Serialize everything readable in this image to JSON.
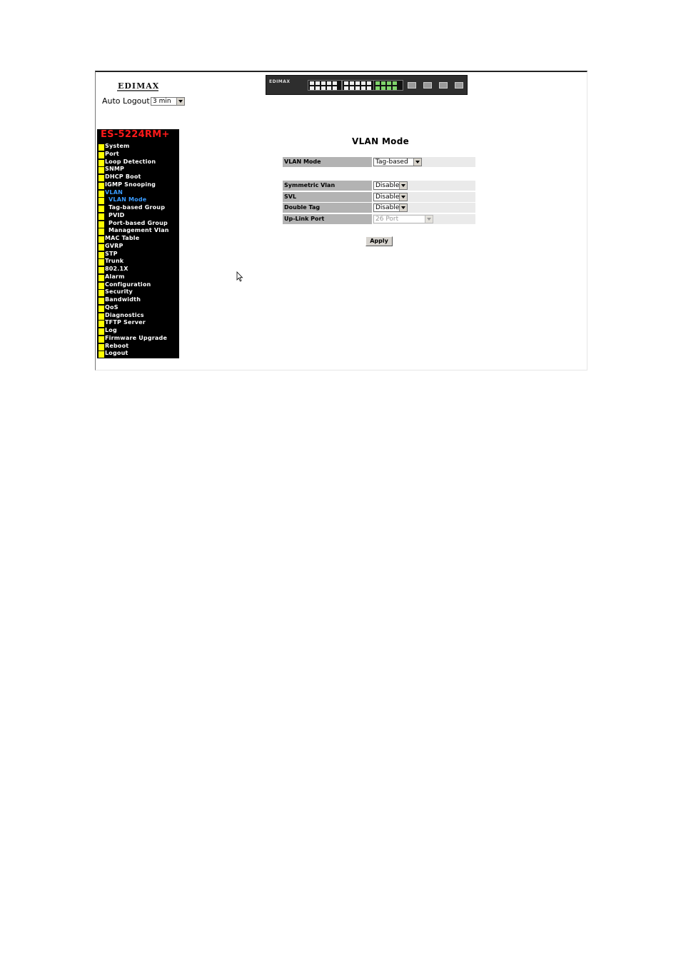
{
  "header": {
    "brand_logo_text": "EDIMAX",
    "auto_logout_label": "Auto Logout",
    "auto_logout_value": "3 min",
    "switch_panel_brand": "EDIMAX"
  },
  "sidebar": {
    "model": "ES-5224RM+",
    "items": [
      {
        "label": "System",
        "indent": false,
        "active": false
      },
      {
        "label": "Port",
        "indent": false,
        "active": false
      },
      {
        "label": "Loop Detection",
        "indent": false,
        "active": false
      },
      {
        "label": "SNMP",
        "indent": false,
        "active": false
      },
      {
        "label": "DHCP Boot",
        "indent": false,
        "active": false
      },
      {
        "label": "IGMP Snooping",
        "indent": false,
        "active": false
      },
      {
        "label": "VLAN",
        "indent": false,
        "active": true
      },
      {
        "label": "VLAN Mode",
        "indent": true,
        "active": true
      },
      {
        "label": "Tag-based Group",
        "indent": true,
        "active": false
      },
      {
        "label": "PVID",
        "indent": true,
        "active": false
      },
      {
        "label": "Port-based Group",
        "indent": true,
        "active": false
      },
      {
        "label": "Management Vlan",
        "indent": true,
        "active": false
      },
      {
        "label": "MAC Table",
        "indent": false,
        "active": false
      },
      {
        "label": "GVRP",
        "indent": false,
        "active": false
      },
      {
        "label": "STP",
        "indent": false,
        "active": false
      },
      {
        "label": "Trunk",
        "indent": false,
        "active": false
      },
      {
        "label": "802.1X",
        "indent": false,
        "active": false
      },
      {
        "label": "Alarm",
        "indent": false,
        "active": false
      },
      {
        "label": "Configuration",
        "indent": false,
        "active": false
      },
      {
        "label": "Security",
        "indent": false,
        "active": false
      },
      {
        "label": "Bandwidth",
        "indent": false,
        "active": false
      },
      {
        "label": "QoS",
        "indent": false,
        "active": false
      },
      {
        "label": "Diagnostics",
        "indent": false,
        "active": false
      },
      {
        "label": "TFTP Server",
        "indent": false,
        "active": false
      },
      {
        "label": "Log",
        "indent": false,
        "active": false
      },
      {
        "label": "Firmware Upgrade",
        "indent": false,
        "active": false
      },
      {
        "label": "Reboot",
        "indent": false,
        "active": false
      },
      {
        "label": "Logout",
        "indent": false,
        "active": false
      }
    ]
  },
  "main": {
    "title": "VLAN Mode",
    "vlan_mode": {
      "label": "VLAN Mode",
      "value": "Tag-based"
    },
    "symmetric_vlan": {
      "label": "Symmetric Vlan",
      "value": "Disable"
    },
    "svl": {
      "label": "SVL",
      "value": "Disable"
    },
    "double_tag": {
      "label": "Double Tag",
      "value": "Disable"
    },
    "uplink_port": {
      "label": "Up-Link Port",
      "value": "26 Port",
      "disabled": true
    },
    "apply_label": "Apply"
  },
  "colors": {
    "sidebar_bg": "#000000",
    "model_text": "#ff1a1a",
    "nav_square": "#ffff00",
    "nav_active": "#3a9cff",
    "label_cell": "#b3b3b3",
    "value_cell": "#eaeaea"
  }
}
